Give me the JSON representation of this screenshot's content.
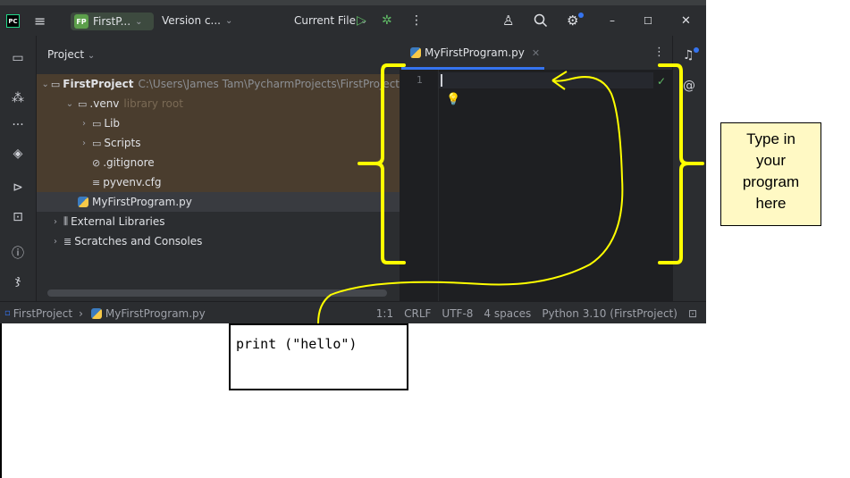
{
  "titlebar": {
    "app_logo": "PC",
    "project_badge": "FP",
    "project_name": "FirstP...",
    "vcs_label": "Version c...",
    "run_config": "Current File",
    "icons": [
      "hamburger-menu-icon",
      "run-icon",
      "debug-icon",
      "more-icon",
      "add-user-icon",
      "search-icon",
      "settings-icon",
      "minimize-icon",
      "maximize-icon",
      "close-icon"
    ]
  },
  "left_toolbar": {
    "icons": [
      "folder-icon",
      "structure-icon",
      "more-icon",
      "layers-icon",
      "play-circle-icon",
      "terminal-icon",
      "problems-icon",
      "git-icon"
    ]
  },
  "project_panel": {
    "header": "Project",
    "tree": [
      {
        "label": "FirstProject",
        "path": "C:\\Users\\James Tam\\PycharmProjects\\FirstProject",
        "expanded": true
      },
      {
        "label": ".venv",
        "note": "library root",
        "expanded": true
      },
      {
        "label": "Lib",
        "expanded": false
      },
      {
        "label": "Scripts",
        "expanded": false
      },
      {
        "label": ".gitignore"
      },
      {
        "label": "pyvenv.cfg"
      },
      {
        "label": "MyFirstProgram.py"
      },
      {
        "label": "External Libraries",
        "expanded": false
      },
      {
        "label": "Scratches and Consoles",
        "expanded": false
      }
    ]
  },
  "editor": {
    "tab_label": "MyFirstProgram.py",
    "line_number": "1",
    "inspection_ok": "✓"
  },
  "statusbar": {
    "breadcrumb_project": "FirstProject",
    "breadcrumb_file": "MyFirstProgram.py",
    "position": "1:1",
    "line_ending": "CRLF",
    "encoding": "UTF-8",
    "indent": "4 spaces",
    "interpreter": "Python 3.10 (FirstProject)"
  },
  "annotations": {
    "callout_lines": [
      "Type in",
      "your",
      "program",
      "here"
    ],
    "code_sample": "print (\"hello\")",
    "highlight_color": "#ffff00"
  }
}
